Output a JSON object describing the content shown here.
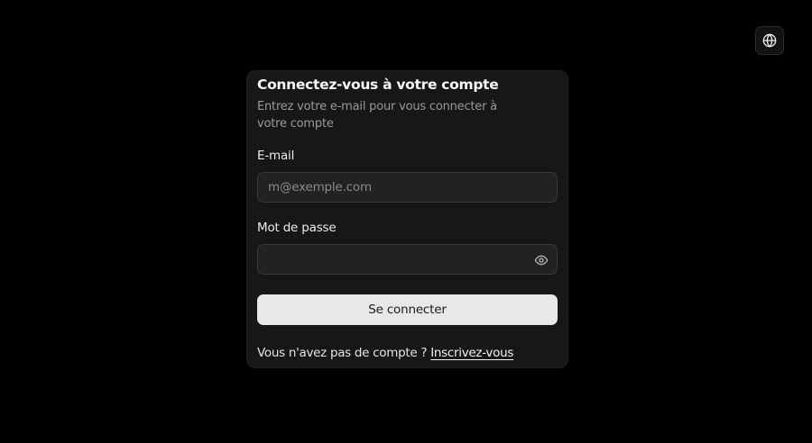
{
  "header": {
    "language_icon": "globe-icon"
  },
  "login": {
    "title": "Connectez-vous à votre compte",
    "subtitle": "Entrez votre e-mail pour vous connecter à votre compte",
    "email_label": "E-mail",
    "email_placeholder": "m@exemple.com",
    "email_value": "",
    "password_label": "Mot de passe",
    "password_value": "",
    "password_toggle_icon": "eye-icon",
    "submit_label": "Se connecter",
    "signup_prompt": "Vous n'avez pas de compte ?",
    "signup_link": "Inscrivez-vous"
  },
  "colors": {
    "background": "#000000",
    "card": "#171717",
    "input_background": "#222222",
    "input_border": "#383838",
    "button_background": "#e8e8e8",
    "button_text": "#1a1a1a",
    "muted_text": "#9a9a9a"
  }
}
